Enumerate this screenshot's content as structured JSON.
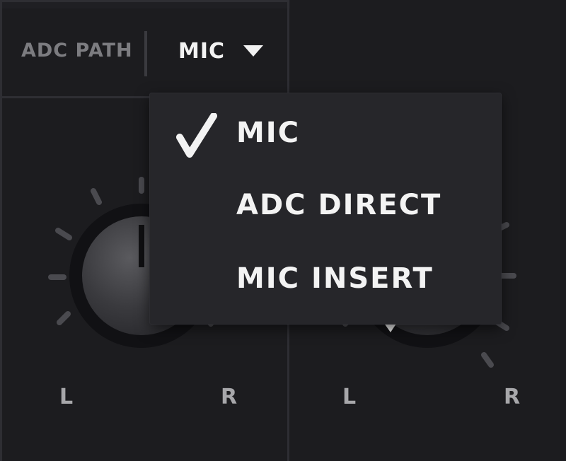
{
  "header": {
    "label": "ADC PATH",
    "selected_value": "MIC"
  },
  "dropdown": {
    "items": [
      {
        "label": "MIC",
        "checked": true
      },
      {
        "label": "ADC DIRECT",
        "checked": false
      },
      {
        "label": "MIC INSERT",
        "checked": false
      }
    ]
  },
  "knobs": [
    {
      "left_label": "L",
      "right_label": "R"
    },
    {
      "left_label": "L",
      "right_label": "R"
    }
  ],
  "icons": {
    "caret": "caret-down-icon",
    "check": "checkmark-icon"
  }
}
